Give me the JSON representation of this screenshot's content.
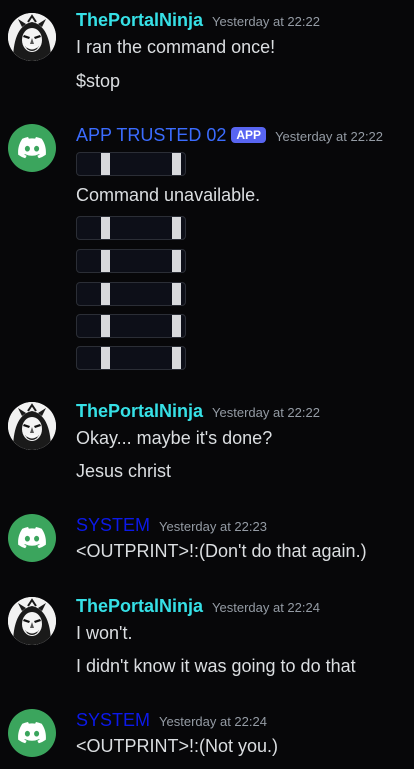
{
  "messages": [
    {
      "author": "ThePortalNinja",
      "timestamp": "Yesterday at 22:22",
      "lines": [
        "I ran the command once!",
        "$stop"
      ]
    },
    {
      "author": "APP TRUSTED 02",
      "badge": "APP",
      "timestamp": "Yesterday at 22:22",
      "lines": [
        "Command unavailable."
      ]
    },
    {
      "author": "ThePortalNinja",
      "timestamp": "Yesterday at 22:22",
      "lines": [
        "Okay... maybe it's done?",
        "Jesus christ"
      ]
    },
    {
      "author": "SYSTEM",
      "timestamp": "Yesterday at 22:23",
      "lines": [
        "<OUTPRINT>!:(Don't do that again.)"
      ]
    },
    {
      "author": "ThePortalNinja",
      "timestamp": "Yesterday at 22:24",
      "lines": [
        "I won't.",
        "I didn't know it was going to do that"
      ]
    },
    {
      "author": "SYSTEM",
      "timestamp": "Yesterday at 22:24",
      "lines": [
        "<OUTPRINT>!:(Not you.)"
      ]
    }
  ],
  "colors": {
    "background": "#070709",
    "ninja_name": "#36e0e6",
    "trusted_name": "#3b6cff",
    "system_name": "#0c19e8",
    "app_badge": "#5865f2",
    "discord_avatar": "#3ba55d"
  },
  "icons": {
    "ninja_avatar": "ninja-avatar-icon",
    "bot_avatar": "discord-logo-icon",
    "glyph_box": "glyph-box-icon"
  }
}
